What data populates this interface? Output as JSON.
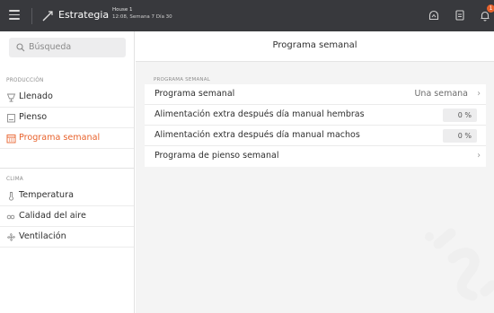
{
  "topbar": {
    "strategy_label": "Estrategia",
    "house_name": "House 1",
    "house_info": "12:08, Semana 7 Día 30",
    "notification_count": "1"
  },
  "sidebar": {
    "search_placeholder": "Búsqueda",
    "sections": [
      {
        "title": "PRODUCCIÓN",
        "items": [
          {
            "label": "Llenado",
            "icon": "feeder-icon"
          },
          {
            "label": "Pienso",
            "icon": "feed-sack-icon"
          },
          {
            "label": "Programa semanal",
            "icon": "calendar-icon",
            "active": true
          }
        ]
      },
      {
        "title": "CLIMA",
        "items": [
          {
            "label": "Temperatura",
            "icon": "thermometer-icon"
          },
          {
            "label": "Calidad del aire",
            "icon": "air-quality-icon"
          },
          {
            "label": "Ventilación",
            "icon": "fan-icon"
          }
        ]
      }
    ]
  },
  "main": {
    "title": "Programa semanal",
    "group_label": "PROGRAMA SEMANAL",
    "rows": [
      {
        "label": "Programa semanal",
        "value": "Una semana",
        "chevron": "›"
      },
      {
        "label": "Alimentación extra después día manual hembras",
        "value": "0 %"
      },
      {
        "label": "Alimentación extra después día manual machos",
        "value": "0 %"
      },
      {
        "label": "Programa de pienso semanal",
        "chevron": "›"
      }
    ]
  },
  "colors": {
    "topbar_bg": "#38393d",
    "accent": "#e8622c",
    "main_bg": "#f4f4f4"
  }
}
